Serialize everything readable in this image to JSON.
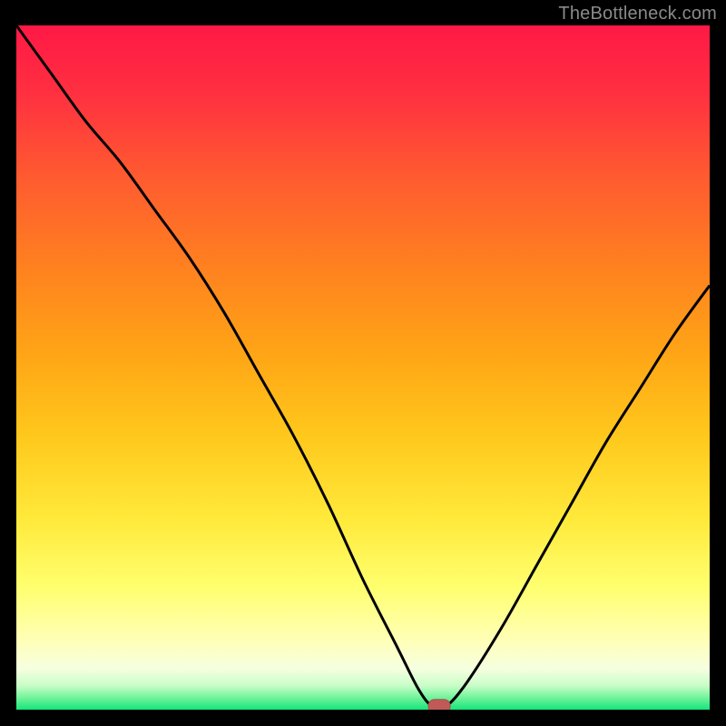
{
  "watermark": "TheBottleneck.com",
  "colors": {
    "frame": "#000000",
    "watermark_text": "#8a8a8a",
    "curve_stroke": "#000000",
    "marker_fill": "#c05a58",
    "marker_stroke": "#b04a48",
    "gradient_stops": [
      {
        "offset": 0.0,
        "color": "#ff1846"
      },
      {
        "offset": 0.1,
        "color": "#ff3040"
      },
      {
        "offset": 0.22,
        "color": "#ff5a30"
      },
      {
        "offset": 0.35,
        "color": "#ff8020"
      },
      {
        "offset": 0.48,
        "color": "#ffa516"
      },
      {
        "offset": 0.6,
        "color": "#ffc81c"
      },
      {
        "offset": 0.72,
        "color": "#ffe93a"
      },
      {
        "offset": 0.82,
        "color": "#ffff6e"
      },
      {
        "offset": 0.9,
        "color": "#ffffb8"
      },
      {
        "offset": 0.94,
        "color": "#f6ffe0"
      },
      {
        "offset": 0.965,
        "color": "#c8fdc8"
      },
      {
        "offset": 0.98,
        "color": "#7ef5a0"
      },
      {
        "offset": 1.0,
        "color": "#14e67a"
      }
    ]
  },
  "chart_data": {
    "type": "line",
    "title": "",
    "xlabel": "",
    "ylabel": "",
    "xlim": [
      0,
      100
    ],
    "ylim": [
      0,
      100
    ],
    "grid": false,
    "legend": false,
    "series": [
      {
        "name": "bottleneck-curve",
        "x": [
          0,
          5,
          10,
          15,
          20,
          25,
          30,
          35,
          40,
          45,
          50,
          55,
          58,
          60,
          62,
          65,
          70,
          75,
          80,
          85,
          90,
          95,
          100
        ],
        "values": [
          100,
          93,
          86,
          80,
          73,
          66,
          58,
          49,
          40,
          30,
          19,
          9,
          3,
          0.5,
          0.5,
          4,
          12,
          21,
          30,
          39,
          47,
          55,
          62
        ]
      }
    ],
    "annotations": [
      {
        "type": "marker",
        "name": "optimum-marker",
        "x": 61,
        "y": 0.5
      }
    ]
  }
}
